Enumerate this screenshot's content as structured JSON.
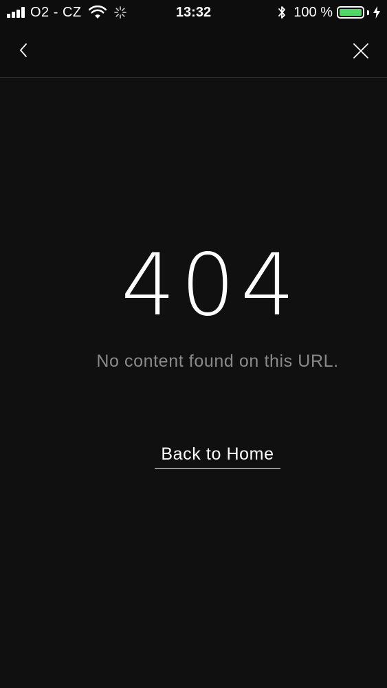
{
  "status_bar": {
    "carrier": "O2 - CZ",
    "time": "13:32",
    "battery_percent_text": "100 %",
    "battery_level": 1.0,
    "battery_color": "#4cd964",
    "signal_icon": "cellular-signal-icon",
    "wifi_icon": "wifi-icon",
    "activity_icon": "network-activity-spinner-icon",
    "bluetooth_icon": "bluetooth-icon",
    "charging_icon": "charging-bolt-icon"
  },
  "nav_bar": {
    "back_icon": "chevron-left-icon",
    "close_icon": "close-icon"
  },
  "error": {
    "code": "404",
    "message": "No content found on this URL."
  },
  "actions": {
    "home_link_label": "Back to Home"
  },
  "colors": {
    "background": "#101010",
    "text_primary": "#ffffff",
    "text_secondary": "#8a8a8a"
  }
}
